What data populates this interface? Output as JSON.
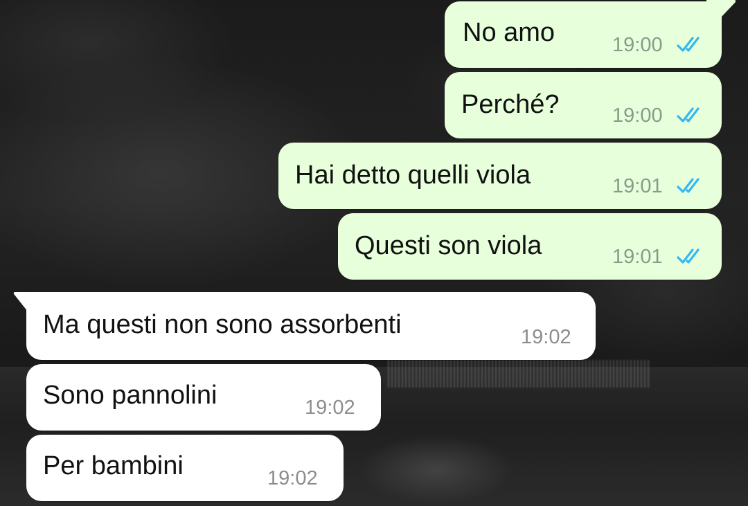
{
  "colors": {
    "outgoing_bubble": "#e7ffdb",
    "incoming_bubble": "#ffffff",
    "read_ticks": "#34b7f1",
    "timestamp_gray": "#8d8d8d"
  },
  "messages": [
    {
      "direction": "outgoing",
      "text": "No amo",
      "time": "19:00",
      "status_icon": "double-check-read-icon"
    },
    {
      "direction": "outgoing",
      "text": "Perché?",
      "time": "19:00",
      "status_icon": "double-check-read-icon"
    },
    {
      "direction": "outgoing",
      "text": "Hai detto quelli viola",
      "time": "19:01",
      "status_icon": "double-check-read-icon"
    },
    {
      "direction": "outgoing",
      "text": "Questi son viola",
      "time": "19:01",
      "status_icon": "double-check-read-icon"
    },
    {
      "direction": "incoming",
      "text": "Ma questi non sono assorbenti",
      "time": "19:02"
    },
    {
      "direction": "incoming",
      "text": "Sono pannolini",
      "time": "19:02"
    },
    {
      "direction": "incoming",
      "text": "Per bambini",
      "time": "19:02"
    }
  ]
}
